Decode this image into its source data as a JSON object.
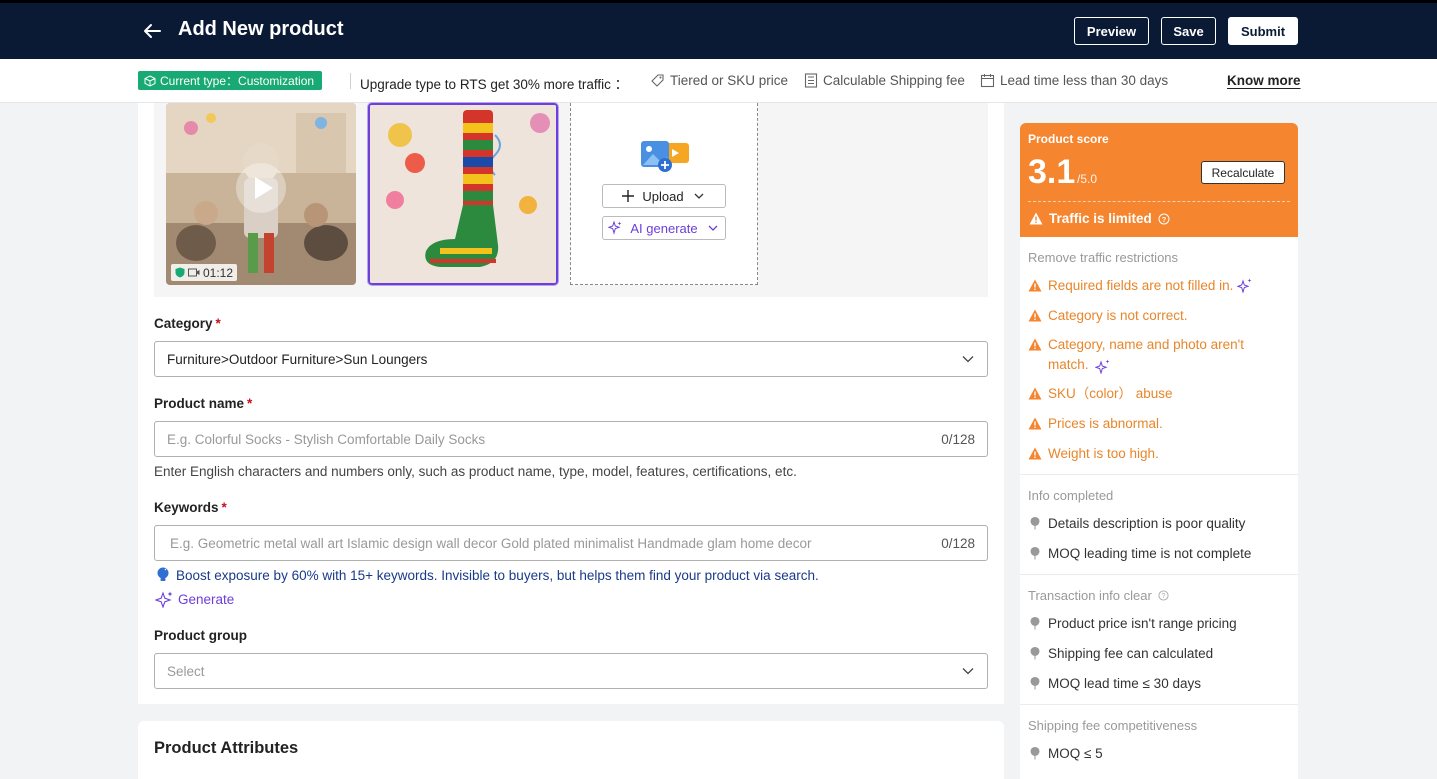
{
  "header": {
    "title": "Add New product",
    "preview_label": "Preview",
    "save_label": "Save",
    "submit_label": "Submit"
  },
  "typebar": {
    "badge": "Current type：Customization",
    "upgrade": "Upgrade type to RTS get 30% more traffic ：",
    "features": [
      "Tiered or SKU price",
      "Calculable Shipping fee",
      "Lead time less than 30 days"
    ],
    "know_more": "Know more"
  },
  "media": {
    "video_duration": "01:12",
    "upload_label": "Upload",
    "ai_label": "AI generate"
  },
  "form": {
    "category": {
      "label": "Category",
      "required_mark": "*",
      "value": "Furniture>Outdoor Furniture>Sun Loungers"
    },
    "product_name": {
      "label": "Product name",
      "required_mark": "*",
      "placeholder": "E.g. Colorful Socks - Stylish Comfortable Daily Socks",
      "counter": "0/128",
      "helper": "Enter English characters and numbers only, such as product name, type, model, features, certifications, etc."
    },
    "keywords": {
      "label": "Keywords",
      "required_mark": "*",
      "placeholder": "E.g. Geometric metal wall art Islamic design wall decor Gold plated minimalist Handmade glam home decor",
      "counter": "0/128",
      "tip": "Boost exposure by 60% with 15+ keywords. Invisible to buyers, but helps them find your product via search.",
      "generate": "Generate"
    },
    "product_group": {
      "label": "Product group",
      "placeholder": "Select"
    }
  },
  "attributes": {
    "title": "Product Attributes"
  },
  "score": {
    "label": "Product score",
    "value": "3.1",
    "max": "/5.0",
    "recalc_label": "Recalculate",
    "traffic": "Traffic is limited",
    "remove_title": "Remove traffic restrictions",
    "issues": [
      "Required fields are not filled in.",
      "Category is not correct.",
      "Category, name and photo aren't match.",
      "SKU（color） abuse",
      "Prices is abnormal.",
      "Weight is too high."
    ],
    "info_title": "Info completed",
    "info_items": [
      "Details description is poor quality",
      "MOQ leading time is not complete"
    ],
    "transaction_title": "Transaction info clear",
    "transaction_items": [
      "Product price isn't range pricing",
      "Shipping fee can calculated",
      "MOQ lead time ≤ 30 days"
    ],
    "shipping_title": "Shipping fee competitiveness",
    "shipping_items": [
      "MOQ ≤ 5"
    ]
  },
  "colors": {
    "navy": "#0a1a35",
    "badge_green": "#19a974",
    "score_orange": "#f5852e",
    "warning_orange": "#e8862a",
    "ai_purple": "#6c3fd8"
  }
}
